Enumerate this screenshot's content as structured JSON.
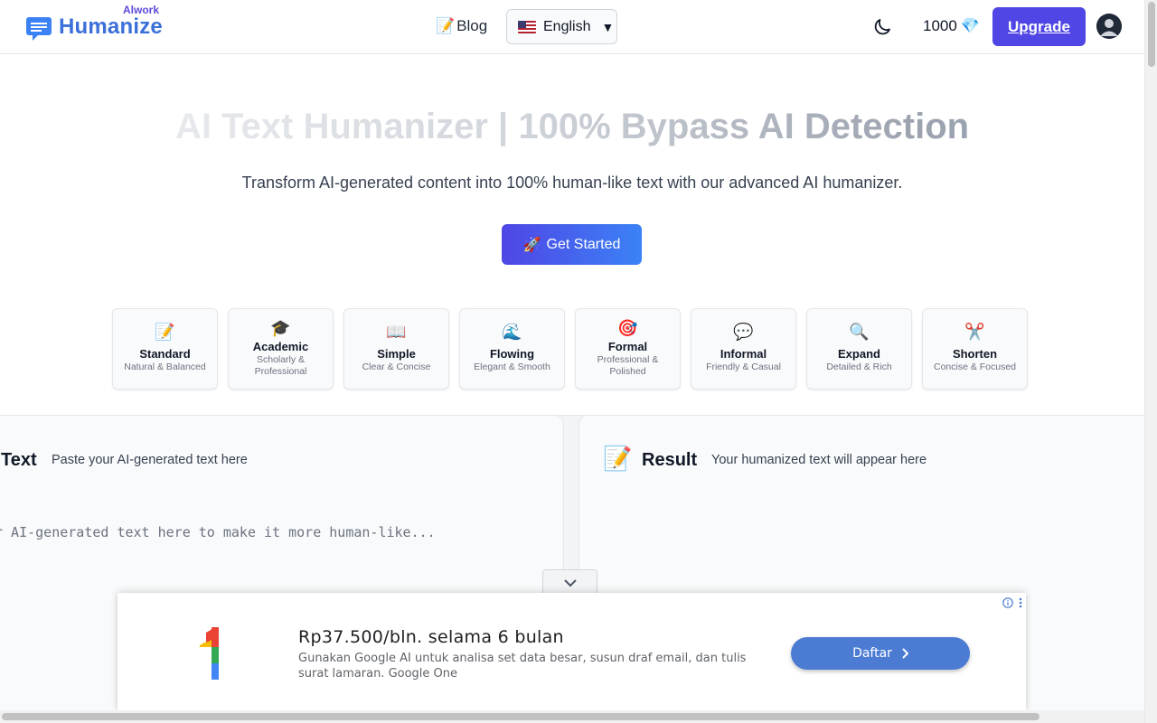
{
  "header": {
    "logo_small": "Alwork",
    "logo_main": "Humanize",
    "blog_emoji": "📝",
    "blog_label": "Blog",
    "language": "English",
    "credits": "1000",
    "credits_icon": "💎",
    "upgrade_label": "Upgrade"
  },
  "hero": {
    "title": "AI Text Humanizer | 100% Bypass AI Detection",
    "subtitle": "Transform AI-generated content into 100% human-like text with our advanced AI humanizer.",
    "cta_emoji": "🚀",
    "cta_label": "Get Started"
  },
  "modes": [
    {
      "emoji": "📝",
      "name": "Standard",
      "desc": "Natural & Balanced"
    },
    {
      "emoji": "🎓",
      "name": "Academic",
      "desc": "Scholarly & Professional"
    },
    {
      "emoji": "📖",
      "name": "Simple",
      "desc": "Clear & Concise"
    },
    {
      "emoji": "🌊",
      "name": "Flowing",
      "desc": "Elegant & Smooth"
    },
    {
      "emoji": "🎯",
      "name": "Formal",
      "desc": "Professional & Polished"
    },
    {
      "emoji": "💬",
      "name": "Informal",
      "desc": "Friendly & Casual"
    },
    {
      "emoji": "🔍",
      "name": "Expand",
      "desc": "Detailed & Rich"
    },
    {
      "emoji": "✂️",
      "name": "Shorten",
      "desc": "Concise & Focused"
    }
  ],
  "input_panel": {
    "title": "Text",
    "subtitle": "Paste your AI-generated text here",
    "placeholder": "r AI-generated text here to make it more human-like..."
  },
  "result_panel": {
    "emoji": "📝",
    "title": "Result",
    "subtitle": "Your humanized text will appear here"
  },
  "ad": {
    "headline": "Rp37.500/bln. selama 6 bulan",
    "body": "Gunakan Google AI untuk analisa set data besar, susun draf email, dan tulis surat lamaran. Google One",
    "button_label": "Daftar"
  }
}
